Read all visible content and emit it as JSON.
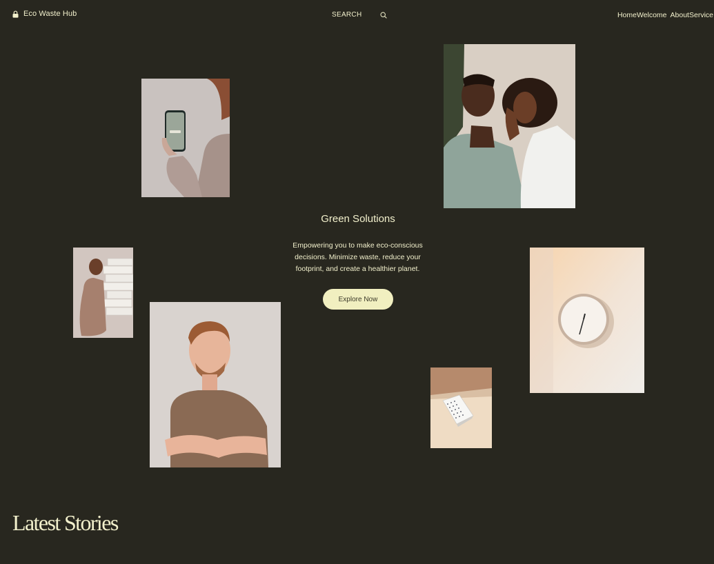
{
  "header": {
    "site_name": "Eco Waste Hub",
    "logo_icon": "lock-icon",
    "search_label": "SEARCH",
    "search_icon": "search-icon",
    "nav": [
      "Home",
      "Welcome",
      "About",
      "Service"
    ]
  },
  "hero": {
    "title": "Green Solutions",
    "description": "Empowering you to make eco-conscious decisions. Minimize waste, reduce your footprint, and create a healthier planet.",
    "cta_label": "Explore Now"
  },
  "section": {
    "title": "Latest Stories"
  },
  "colors": {
    "background": "#28271f",
    "text": "#f2f0cc",
    "button_bg": "#f1efc0",
    "button_text": "#3a3828"
  }
}
